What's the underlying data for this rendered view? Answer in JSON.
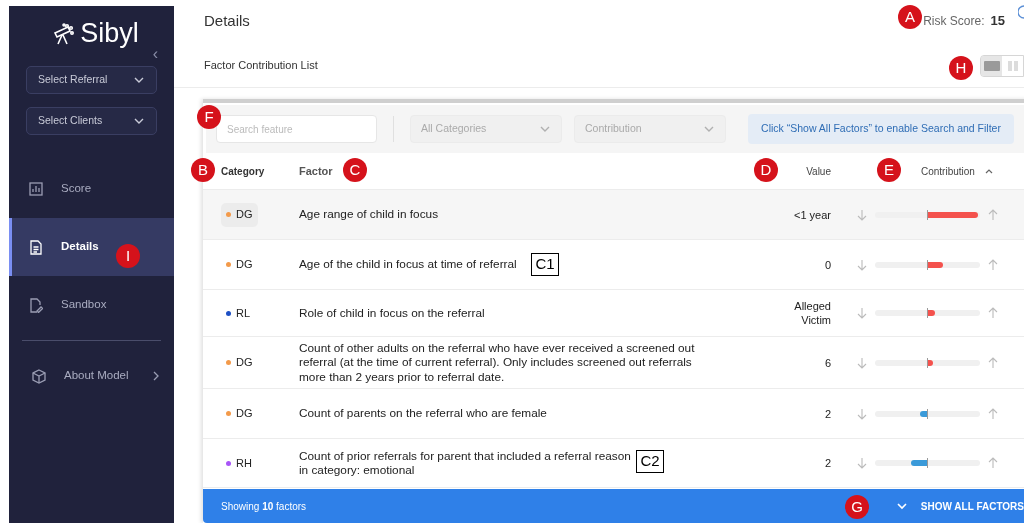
{
  "sidebar": {
    "logo": "Sibyl",
    "collapse_icon": "‹",
    "selects": [
      {
        "label": "Select Referral"
      },
      {
        "label": "Select Clients"
      }
    ],
    "items": [
      {
        "label": "Score",
        "kind": "chart",
        "selected": false,
        "has_submenu": false
      },
      {
        "label": "Details",
        "kind": "document",
        "selected": true,
        "has_submenu": false
      },
      {
        "label": "Sandbox",
        "kind": "edit",
        "selected": false,
        "has_submenu": false
      },
      {
        "label": "About Model",
        "kind": "cube",
        "selected": false,
        "has_submenu": true
      }
    ]
  },
  "header": {
    "title": "Details",
    "risk_label": "Risk Score:",
    "risk_value": "15"
  },
  "subheader": {
    "title": "Factor Contribution List",
    "view_toggle": [
      {
        "selected": true
      },
      {
        "selected": false
      }
    ]
  },
  "filters": {
    "search": {
      "placeholder": "Search feature"
    },
    "selects": [
      "All Categories",
      "Contribution"
    ],
    "notice": "Click “Show All Factors” to enable Search and Filter"
  },
  "table": {
    "columns": [
      "Category",
      "Factor",
      "Value",
      "Contribution"
    ],
    "rows": [
      {
        "category": "DG",
        "color": "#f39a4a",
        "factor": "Age range of child in focus",
        "value": "<1 year",
        "increase": {
          "level": 0.96
        },
        "highlighted": true
      },
      {
        "category": "DG",
        "color": "#f39a4a",
        "factor": "Age of the child in focus at time of referral",
        "value": "0",
        "increase": {
          "level": 0.29
        },
        "highlighted": false
      },
      {
        "category": "RL",
        "color": "#1d4fc4",
        "factor": "Role of child in focus on the referral",
        "value": "Alleged Victim",
        "increase": {
          "level": 0.13
        },
        "highlighted": false
      },
      {
        "category": "DG",
        "color": "#f39a4a",
        "factor": "Count of other adults on the referral who have ever received a screened out referral (at the time of current referral). Only includes screened out referrals more than 2 years prior to referral date.",
        "value": "6",
        "increase": {
          "level": 0.1
        },
        "highlighted": false
      },
      {
        "category": "DG",
        "color": "#f39a4a",
        "factor": "Count of parents on the referral who are female",
        "value": "2",
        "decrease": {
          "level": 0.13
        },
        "highlighted": false
      },
      {
        "category": "RH",
        "color": "#a855f7",
        "factor": "Count of prior referrals for parent that included a referral reason in category: emotional",
        "value": "2",
        "decrease": {
          "level": 0.31
        },
        "highlighted": false
      }
    ]
  },
  "footer": {
    "summary": "Showing **10** factors",
    "button": "SHOW ALL FACTORS"
  },
  "annotations": [
    {
      "label": "A",
      "kind": "circle"
    },
    {
      "label": "B",
      "kind": "circle"
    },
    {
      "label": "C",
      "kind": "circle"
    },
    {
      "label": "D",
      "kind": "circle"
    },
    {
      "label": "E",
      "kind": "circle"
    },
    {
      "label": "F",
      "kind": "circle"
    },
    {
      "label": "G",
      "kind": "circle"
    },
    {
      "label": "H",
      "kind": "circle"
    },
    {
      "label": "I",
      "kind": "circle"
    },
    {
      "label": "C1",
      "kind": "box"
    },
    {
      "label": "C2",
      "kind": "box"
    }
  ]
}
